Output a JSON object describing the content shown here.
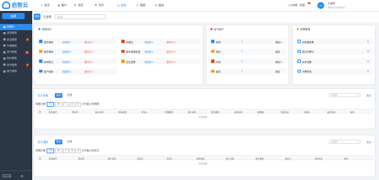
{
  "brand": {
    "logo": "启智云",
    "sub": "qizhi.com"
  },
  "sidebar": {
    "top_button": "新建",
    "items": [
      {
        "label": "控制台",
        "active": true,
        "badge": ""
      },
      {
        "label": "风险管理",
        "badge": ""
      },
      {
        "label": "航空管理",
        "badge": "4"
      },
      {
        "label": "车辆管理",
        "badge": ""
      },
      {
        "label": "资产管理",
        "badge": "23"
      },
      {
        "label": "报价管理",
        "badge": ""
      },
      {
        "label": "财务管理",
        "badge": "4"
      },
      {
        "label": "客户管理",
        "badge": ""
      }
    ]
  },
  "topnav": {
    "items": [
      {
        "icon": "⌂",
        "label": "首页"
      },
      {
        "icon": "♟",
        "label": "客户"
      },
      {
        "icon": "⚙",
        "label": "项目"
      },
      {
        "icon": "⚑",
        "label": "专利"
      },
      {
        "icon": "◎",
        "label": "商标",
        "active": true
      },
      {
        "icon": "◷",
        "label": "版权"
      },
      {
        "icon": "⊕",
        "label": "服务"
      }
    ],
    "right": {
      "sep": "|",
      "lang": "小布德",
      "notice": "消息",
      "notice_badge": "3",
      "avatar": "Av",
      "user": "王金荣",
      "company": "中国知识产权服务中心"
    }
  },
  "toolbar": {
    "ok": "选择",
    "title": "王金荣",
    "search_placeholder": "请选择"
  },
  "todo": {
    "title": "我的待办",
    "rows": [
      [
        {
          "label": "委托审核",
          "v1": "待处理 0",
          "v2": "进行中 0",
          "color": "#2d8cf0"
        },
        {
          "label": "待提交",
          "v1": "待处理 0",
          "v2": "进行中 0",
          "color": "#ed4014"
        }
      ],
      [
        {
          "label": "案件审核",
          "v1": "待处理 0",
          "v2": "进行中 0",
          "color": "#ff9900"
        },
        {
          "label": "新件审核处理",
          "v1": "待处理 0",
          "v2": "进行中 0",
          "color": "#ed4014"
        }
      ],
      [
        {
          "label": "待审核文",
          "v1": "待处理 0",
          "v2": "进行中 0",
          "color": "#2d8cf0"
        },
        {
          "label": "待交发票",
          "v1": "待处理 0",
          "v2": "进行中 0",
          "color": "#ff9900"
        }
      ],
      [
        {
          "label": "客户收款",
          "v1": "待处理 0",
          "v2": "进行中 0",
          "color": "#2d8cf0"
        }
      ]
    ]
  },
  "cases": {
    "title": "官方案件",
    "rows": [
      {
        "label": "发明",
        "v1": "0",
        "v2": "新增 0",
        "color": "#2d8cf0"
      },
      {
        "label": "商标",
        "v1": "0",
        "v2": "新增",
        "color": "#ff9900"
      },
      {
        "label": "外观",
        "v1": "0",
        "v2": "新增 0",
        "color": "#ed4014"
      },
      {
        "label": "版权",
        "v1": "0",
        "v2": "新增",
        "color": "#ff9900"
      }
    ]
  },
  "invoice": {
    "title": "发票管理",
    "rows": [
      {
        "label": "待处理发票",
        "v": "0"
      },
      {
        "label": "提交开票中",
        "v": "0"
      },
      {
        "label": "待开发票",
        "v": "0"
      },
      {
        "label": "开票完成",
        "v": "0"
      }
    ]
  },
  "panel1": {
    "title": "官方答复",
    "tab_a": "待办",
    "tab_b": "已完",
    "days_label": "期限日期",
    "chips": [
      "30",
      "15",
      "7",
      "3",
      "0"
    ],
    "after": "天内截止的期限",
    "select": "请选择",
    "link": "更多",
    "cols": [
      "任务编号",
      "申请号",
      "客户名称",
      "申请类型",
      "申请人",
      "代理期限",
      "客户编号",
      "官方期限",
      "案件名称",
      "期限期",
      "任务状态",
      "处理人",
      "是否完成",
      "操作"
    ],
    "empty": "暂无数据"
  },
  "panel2": {
    "title": "官方通知",
    "tab_a": "待办",
    "tab_b": "已完",
    "days_label": "期限日期",
    "chips": [
      "30",
      "15",
      "7",
      "3",
      "0"
    ],
    "after": "天内截止的官文",
    "select": "请选择",
    "link": "更多",
    "cols": [
      "申请编号",
      "申请号",
      "客户名称",
      "申请日",
      "申请人",
      "案件类型",
      "发文日期",
      "官文类型",
      "发文日",
      "案件状态",
      "操作"
    ],
    "empty": "暂无数据"
  }
}
